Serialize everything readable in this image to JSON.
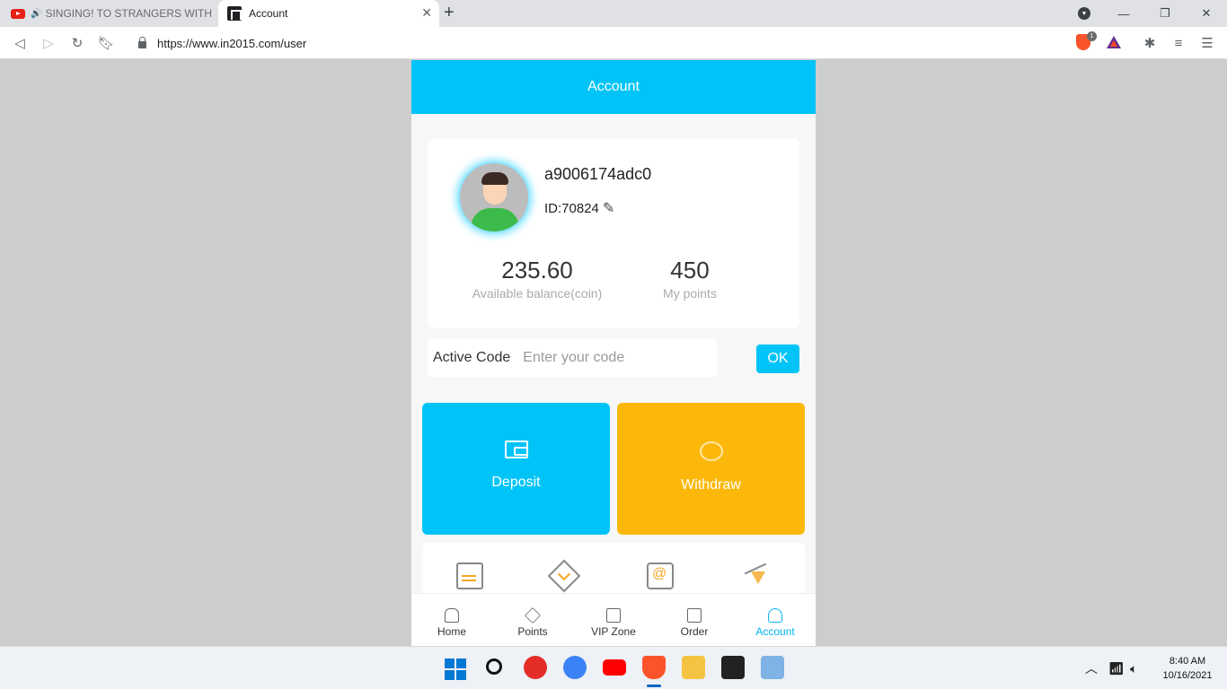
{
  "browser": {
    "tabs": [
      {
        "title": "SINGING! TO STRANGERS WITH M",
        "active": false,
        "audio": true
      },
      {
        "title": "Account",
        "active": true
      }
    ],
    "url": "https://www.in2015.com/user",
    "shield_count": "1"
  },
  "app": {
    "header_title": "Account",
    "profile": {
      "username": "a9006174adc0",
      "id_label": "ID:70824"
    },
    "stats": {
      "balance_value": "235.60",
      "balance_label": "Available balance(coin)",
      "points_value": "450",
      "points_label": "My points"
    },
    "active_code": {
      "label": "Active Code",
      "placeholder": "Enter your code",
      "button": "OK"
    },
    "actions": {
      "deposit": "Deposit",
      "withdraw": "Withdraw"
    },
    "nav": [
      {
        "label": "Home"
      },
      {
        "label": "Points"
      },
      {
        "label": "VIP Zone"
      },
      {
        "label": "Order"
      },
      {
        "label": "Account",
        "active": true
      }
    ],
    "colors": {
      "primary": "#00c4f8",
      "withdraw": "#fbb80a"
    }
  },
  "taskbar": {
    "time": "8:40 AM",
    "date": "10/16/2021"
  }
}
